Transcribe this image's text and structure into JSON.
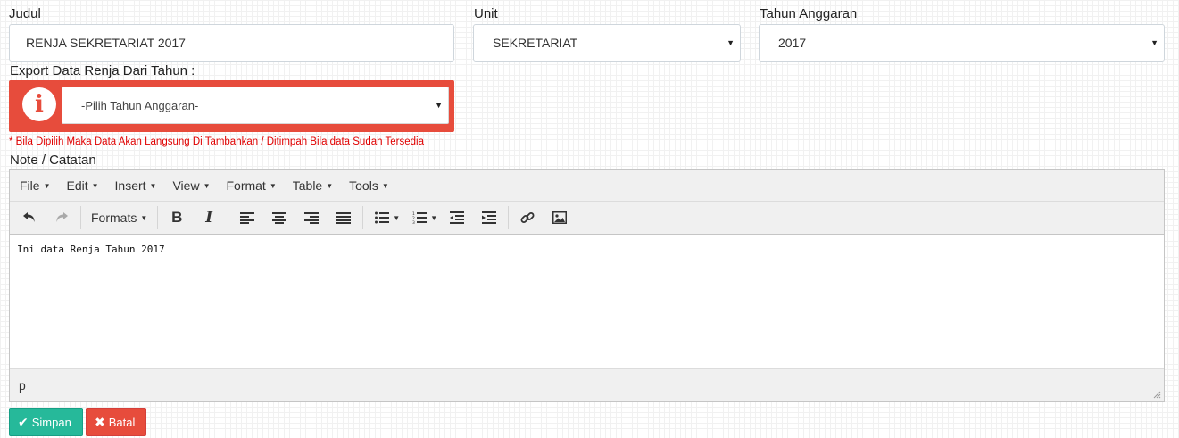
{
  "form": {
    "judul_label": "Judul",
    "judul_value": "RENJA SEKRETARIAT 2017",
    "unit_label": "Unit",
    "unit_value": "SEKRETARIAT",
    "tahun_label": "Tahun Anggaran",
    "tahun_value": "2017",
    "export_label": "Export Data Renja Dari Tahun :",
    "export_value": "-Pilih Tahun Anggaran-",
    "warning": "* Bila Dipilih Maka Data Akan Langsung Di Tambahkan / Ditimpah Bila data Sudah Tersedia",
    "note_label": "Note / Catatan"
  },
  "editor": {
    "menu": [
      "File",
      "Edit",
      "Insert",
      "View",
      "Format",
      "Table",
      "Tools"
    ],
    "formats_label": "Formats",
    "content": "Ini data Renja Tahun 2017",
    "status_path": "p"
  },
  "buttons": {
    "save_label": "Simpan",
    "cancel_label": "Batal"
  },
  "icons": {
    "info": "info-icon",
    "caret": "caret-down-icon"
  },
  "colors": {
    "danger": "#e74c3c",
    "success": "#26b99a",
    "warning_text": "#e00000"
  }
}
